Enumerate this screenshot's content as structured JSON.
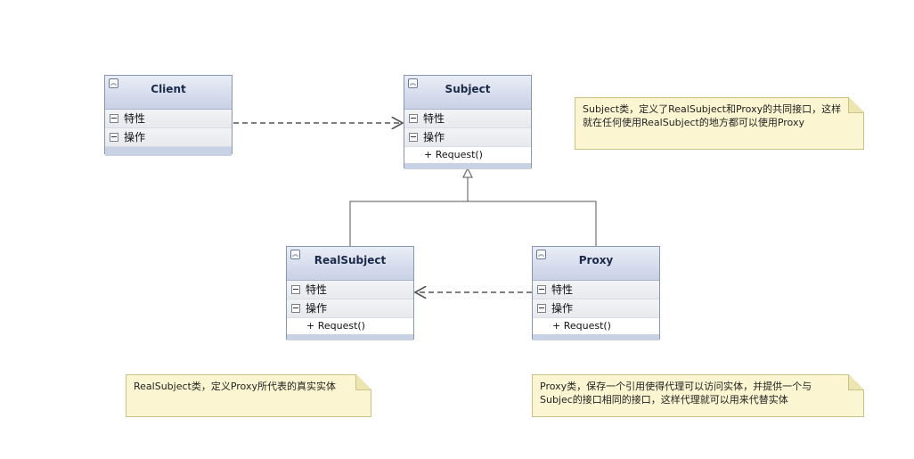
{
  "classes": {
    "client": {
      "name": "Client",
      "attributes_label": "特性",
      "operations_label": "操作",
      "operations": []
    },
    "subject": {
      "name": "Subject",
      "attributes_label": "特性",
      "operations_label": "操作",
      "operations": [
        "+ Request()"
      ]
    },
    "real_subject": {
      "name": "RealSubject",
      "attributes_label": "特性",
      "operations_label": "操作",
      "operations": [
        "+ Request()"
      ]
    },
    "proxy": {
      "name": "Proxy",
      "attributes_label": "特性",
      "operations_label": "操作",
      "operations": [
        "+ Request()"
      ]
    }
  },
  "notes": {
    "subject_note": "Subject类，定义了RealSubject和Proxy的共同接口，这样就在任何使用RealSubject的地方都可以使用Proxy",
    "real_subject_note": "RealSubject类，定义Proxy所代表的真实实体",
    "proxy_note": "Proxy类，保存一个引用使得代理可以访问实体，并提供一个与Subjec的接口相同的接口，这样代理就可以用来代替实体"
  },
  "colors": {
    "class_header": "#c9d1e5",
    "class_border": "#8a97b2",
    "note_fill": "#fbf6d1",
    "connector": "#555555"
  },
  "icons": [
    "collapse-chevron-icon",
    "section-collapse-icon",
    "note-fold-icon"
  ]
}
